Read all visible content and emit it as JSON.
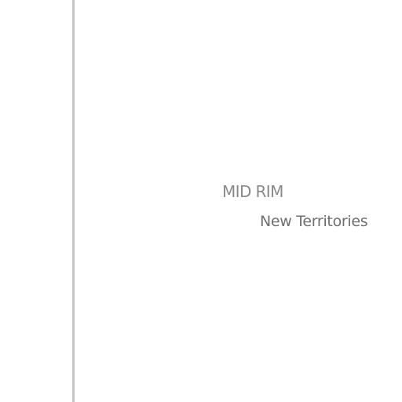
{
  "map": {
    "region_label": "MID RIM",
    "territory_label": "New Territories"
  },
  "colors": {
    "background": "#ffffff",
    "divider": "#c8c8c8",
    "region_text": "#8a8a8a",
    "territory_text": "#6f6f6f"
  }
}
